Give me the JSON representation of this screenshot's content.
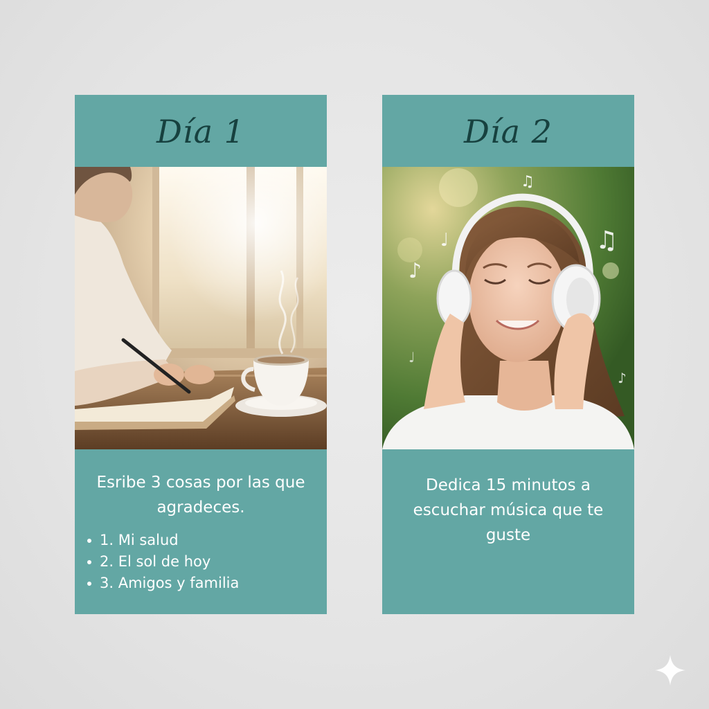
{
  "cards": [
    {
      "title": "Día 1",
      "photo_icon": "journaling-coffee-photo",
      "prompt": "Esribe 3 cosas por las que agradeces.",
      "items": [
        "1. Mi salud",
        "2. El sol de hoy",
        "3. Amigos y familia"
      ]
    },
    {
      "title": "Día 2",
      "photo_icon": "woman-headphones-music-photo",
      "prompt": "Dedica 15 minutos a escuchar música que te guste"
    }
  ],
  "colors": {
    "card_teal": "#63a7a4",
    "title_text": "#17413f",
    "body_text": "#ffffff",
    "background": "#e6e6e6"
  },
  "corner_icon": "sparkle-icon"
}
